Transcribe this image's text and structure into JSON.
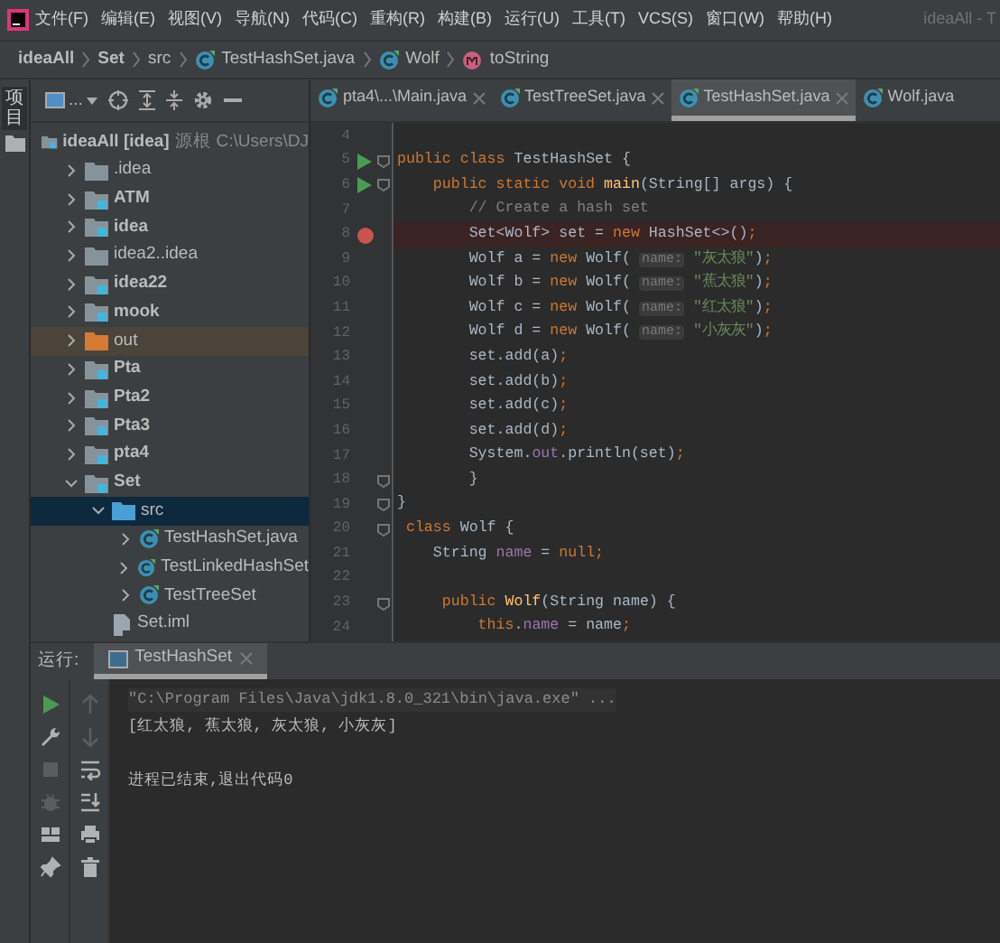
{
  "menu": {
    "items": [
      "文件(F)",
      "编辑(E)",
      "视图(V)",
      "导航(N)",
      "代码(C)",
      "重构(R)",
      "构建(B)",
      "运行(U)",
      "工具(T)",
      "VCS(S)",
      "窗口(W)",
      "帮助(H)"
    ],
    "title": "ideaAll - T"
  },
  "breadcrumb": [
    {
      "kind": "module",
      "label": "ideaAll"
    },
    {
      "kind": "module",
      "label": "Set"
    },
    {
      "kind": "folder",
      "label": "src"
    },
    {
      "kind": "class",
      "label": "TestHashSet.java"
    },
    {
      "kind": "class",
      "label": "Wolf"
    },
    {
      "kind": "method",
      "label": "toString"
    }
  ],
  "side_strip": {
    "label": "项目"
  },
  "project_toolbar": {
    "view_label": "..."
  },
  "editor_tabs": [
    {
      "label": "pta4\\...\\Main.java",
      "selected": false,
      "closable": true
    },
    {
      "label": "TestTreeSet.java",
      "selected": false,
      "closable": true
    },
    {
      "label": "TestHashSet.java",
      "selected": true,
      "closable": true
    },
    {
      "label": "Wolf.java",
      "selected": false,
      "closable": false
    }
  ],
  "project_tree": {
    "root": {
      "label": "ideaAll [idea]",
      "tag": "源根",
      "path": "C:\\Users\\DJ"
    },
    "items": [
      {
        "label": ".idea",
        "kind": "folder",
        "expanded": false
      },
      {
        "label": "ATM",
        "kind": "module",
        "expanded": false
      },
      {
        "label": "idea",
        "kind": "module",
        "expanded": false
      },
      {
        "label": "idea2..idea",
        "kind": "folder",
        "expanded": false
      },
      {
        "label": "idea22",
        "kind": "module",
        "expanded": false
      },
      {
        "label": "mook",
        "kind": "module",
        "expanded": false
      },
      {
        "label": "out",
        "kind": "excluded",
        "expanded": false
      },
      {
        "label": "Pta",
        "kind": "module",
        "expanded": false
      },
      {
        "label": "Pta2",
        "kind": "module",
        "expanded": false
      },
      {
        "label": "Pta3",
        "kind": "module",
        "expanded": false
      },
      {
        "label": "pta4",
        "kind": "module",
        "expanded": false
      },
      {
        "label": "Set",
        "kind": "module",
        "expanded": true,
        "children": [
          {
            "label": "src",
            "kind": "source",
            "expanded": true,
            "selected": true,
            "children": [
              {
                "label": "TestHashSet.java",
                "kind": "class",
                "expanded": false
              },
              {
                "label": "TestLinkedHashSet",
                "kind": "class",
                "expanded": false
              },
              {
                "label": "TestTreeSet",
                "kind": "class",
                "expanded": false
              }
            ]
          },
          {
            "label": "Set.iml",
            "kind": "file"
          }
        ]
      }
    ]
  },
  "code_lines": [
    {
      "number": "4",
      "fold": false
    },
    {
      "number": "5",
      "run_button": true,
      "fold": true,
      "segments": [
        {
          "kind": "kw",
          "text": "public class "
        },
        {
          "kind": "plain",
          "text": "TestHashSet {"
        }
      ]
    },
    {
      "number": "6",
      "run_button": true,
      "fold": true,
      "segments": [
        {
          "kind": "kw",
          "text": "    public static void "
        },
        {
          "kind": "method",
          "text": "main"
        },
        {
          "kind": "plain",
          "text": "(String[] args) {"
        }
      ]
    },
    {
      "number": "7",
      "segments": [
        {
          "kind": "comment",
          "text": "        // Create a hash set"
        }
      ]
    },
    {
      "number": "8",
      "breakpoint": true,
      "highlighted": true,
      "segments": [
        {
          "kind": "plain",
          "text": "        Set<Wolf> set = "
        },
        {
          "kind": "kw",
          "text": "new "
        },
        {
          "kind": "plain",
          "text": "HashSet<>()"
        },
        {
          "kind": "kw",
          "text": ";"
        }
      ]
    },
    {
      "number": "9",
      "segments": [
        {
          "kind": "plain",
          "text": "        Wolf a = "
        },
        {
          "kind": "kw",
          "text": "new "
        },
        {
          "kind": "plain",
          "text": "Wolf( "
        },
        {
          "kind": "hint",
          "text": "name:"
        },
        {
          "kind": "str",
          "text": " \"灰太狼\""
        },
        {
          "kind": "plain",
          "text": ")"
        },
        {
          "kind": "kw",
          "text": ";"
        }
      ]
    },
    {
      "number": "10",
      "segments": [
        {
          "kind": "plain",
          "text": "        Wolf b = "
        },
        {
          "kind": "kw",
          "text": "new "
        },
        {
          "kind": "plain",
          "text": "Wolf( "
        },
        {
          "kind": "hint",
          "text": "name:"
        },
        {
          "kind": "str",
          "text": " \"蕉太狼\""
        },
        {
          "kind": "plain",
          "text": ")"
        },
        {
          "kind": "kw",
          "text": ";"
        }
      ]
    },
    {
      "number": "11",
      "segments": [
        {
          "kind": "plain",
          "text": "        Wolf c = "
        },
        {
          "kind": "kw",
          "text": "new "
        },
        {
          "kind": "plain",
          "text": "Wolf( "
        },
        {
          "kind": "hint",
          "text": "name:"
        },
        {
          "kind": "str",
          "text": " \"红太狼\""
        },
        {
          "kind": "plain",
          "text": ")"
        },
        {
          "kind": "kw",
          "text": ";"
        }
      ]
    },
    {
      "number": "12",
      "segments": [
        {
          "kind": "plain",
          "text": "        Wolf d = "
        },
        {
          "kind": "kw",
          "text": "new "
        },
        {
          "kind": "plain",
          "text": "Wolf( "
        },
        {
          "kind": "hint",
          "text": "name:"
        },
        {
          "kind": "str",
          "text": " \"小灰灰\""
        },
        {
          "kind": "plain",
          "text": ")"
        },
        {
          "kind": "kw",
          "text": ";"
        }
      ]
    },
    {
      "number": "13",
      "segments": [
        {
          "kind": "plain",
          "text": "        set.add(a)"
        },
        {
          "kind": "kw",
          "text": ";"
        }
      ]
    },
    {
      "number": "14",
      "segments": [
        {
          "kind": "plain",
          "text": "        set.add(b)"
        },
        {
          "kind": "kw",
          "text": ";"
        }
      ]
    },
    {
      "number": "15",
      "segments": [
        {
          "kind": "plain",
          "text": "        set.add(c)"
        },
        {
          "kind": "kw",
          "text": ";"
        }
      ]
    },
    {
      "number": "16",
      "segments": [
        {
          "kind": "plain",
          "text": "        set.add(d)"
        },
        {
          "kind": "kw",
          "text": ";"
        }
      ]
    },
    {
      "number": "17",
      "segments": [
        {
          "kind": "plain",
          "text": "        System."
        },
        {
          "kind": "field",
          "text": "out"
        },
        {
          "kind": "plain",
          "text": ".println(set)"
        },
        {
          "kind": "kw",
          "text": ";"
        }
      ]
    },
    {
      "number": "18",
      "fold": true,
      "segments": [
        {
          "kind": "plain",
          "text": "        }"
        }
      ]
    },
    {
      "number": "19",
      "fold": true,
      "segments": [
        {
          "kind": "plain",
          "text": "}"
        }
      ]
    },
    {
      "number": "20",
      "fold": true,
      "segments": [
        {
          "kind": "kw",
          "text": " class "
        },
        {
          "kind": "plain",
          "text": "Wolf {"
        }
      ]
    },
    {
      "number": "21",
      "segments": [
        {
          "kind": "plain",
          "text": "    String "
        },
        {
          "kind": "field",
          "text": "name"
        },
        {
          "kind": "plain",
          "text": " = "
        },
        {
          "kind": "kw",
          "text": "null;"
        }
      ]
    },
    {
      "number": "22"
    },
    {
      "number": "23",
      "fold": true,
      "segments": [
        {
          "kind": "kw",
          "text": "     public "
        },
        {
          "kind": "method",
          "text": "Wolf"
        },
        {
          "kind": "plain",
          "text": "(String name) {"
        }
      ]
    },
    {
      "number": "24",
      "segments": [
        {
          "kind": "kw",
          "text": "         this"
        },
        {
          "kind": "plain",
          "text": "."
        },
        {
          "kind": "field",
          "text": "name"
        },
        {
          "kind": "plain",
          "text": " = name"
        },
        {
          "kind": "kw",
          "text": ";"
        }
      ]
    }
  ],
  "run_panel": {
    "label": "运行:",
    "tabs": [
      {
        "label": "TestHashSet",
        "selected": true,
        "closable": true
      }
    ],
    "console": [
      {
        "kind": "command",
        "text": "\"C:\\Program Files\\Java\\jdk1.8.0_321\\bin\\java.exe\" ..."
      },
      {
        "kind": "output",
        "text": "[红太狼, 蕉太狼, 灰太狼, 小灰灰]"
      },
      {
        "kind": "blank"
      },
      {
        "kind": "output",
        "text": "进程已结束,退出代码0"
      }
    ],
    "tools": [
      {
        "kind": "run",
        "disabled": false
      },
      {
        "kind": "wrench",
        "disabled": false
      },
      {
        "kind": "stop",
        "disabled": true
      },
      {
        "kind": "debug",
        "disabled": true
      },
      {
        "kind": "layout",
        "disabled": false
      },
      {
        "kind": "pin",
        "disabled": false
      }
    ],
    "tools2": [
      {
        "kind": "up",
        "disabled": true
      },
      {
        "kind": "down",
        "disabled": true
      },
      {
        "kind": "wrap",
        "disabled": false
      },
      {
        "kind": "scroll-end",
        "disabled": false
      },
      {
        "kind": "print",
        "disabled": false
      },
      {
        "kind": "trash",
        "disabled": false
      }
    ]
  }
}
